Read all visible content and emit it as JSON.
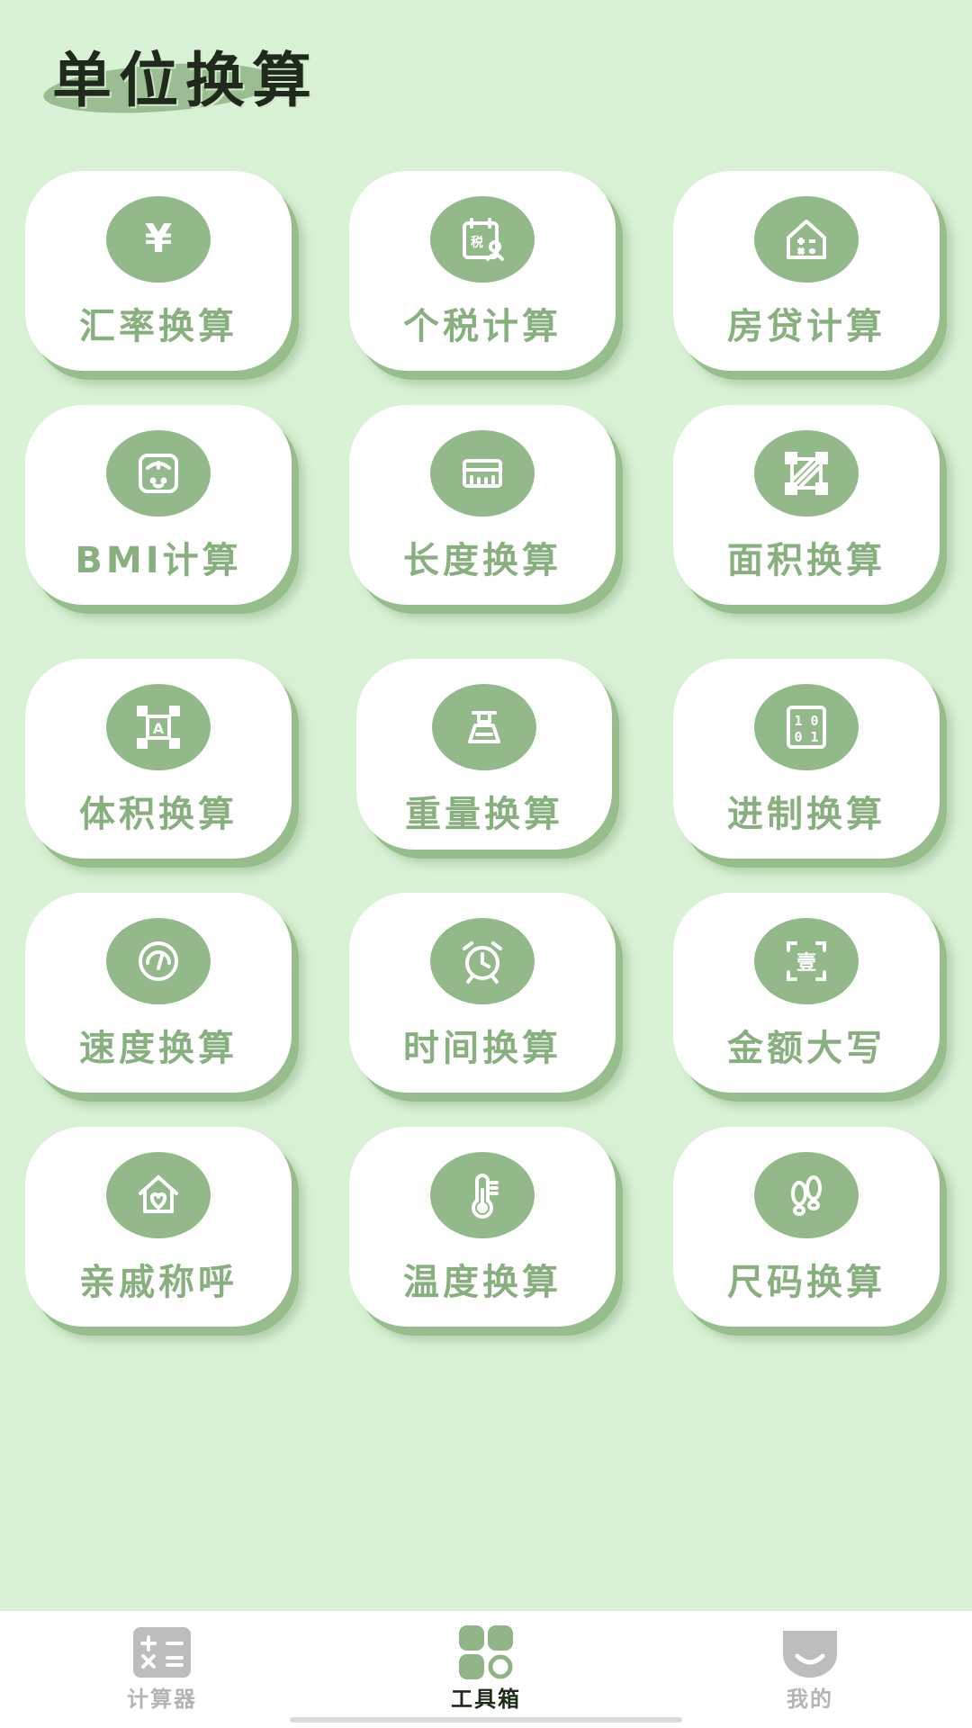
{
  "header": {
    "title": "单位换算"
  },
  "tools": [
    {
      "label": "汇率换算",
      "icon": "yen-icon"
    },
    {
      "label": "个税计算",
      "icon": "tax-icon"
    },
    {
      "label": "房贷计算",
      "icon": "house-calculator-icon"
    },
    {
      "label": "BMI计算",
      "icon": "scale-icon"
    },
    {
      "label": "长度换算",
      "icon": "ruler-icon"
    },
    {
      "label": "面积换算",
      "icon": "area-icon"
    },
    {
      "label": "体积换算",
      "icon": "volume-icon"
    },
    {
      "label": "重量换算",
      "icon": "weight-icon"
    },
    {
      "label": "进制换算",
      "icon": "binary-icon"
    },
    {
      "label": "速度换算",
      "icon": "speedometer-icon"
    },
    {
      "label": "时间换算",
      "icon": "alarm-clock-icon"
    },
    {
      "label": "金额大写",
      "icon": "capital-amount-icon"
    },
    {
      "label": "亲戚称呼",
      "icon": "family-house-icon"
    },
    {
      "label": "温度换算",
      "icon": "thermometer-icon"
    },
    {
      "label": "尺码换算",
      "icon": "footprint-icon"
    }
  ],
  "tabbar": {
    "calculator": "计算器",
    "toolbox": "工具箱",
    "mine": "我的",
    "active": "toolbox"
  },
  "colors": {
    "background": "#d9f1d5",
    "accent": "#93b98a",
    "label": "#88b07f",
    "tile": "#ffffff"
  }
}
